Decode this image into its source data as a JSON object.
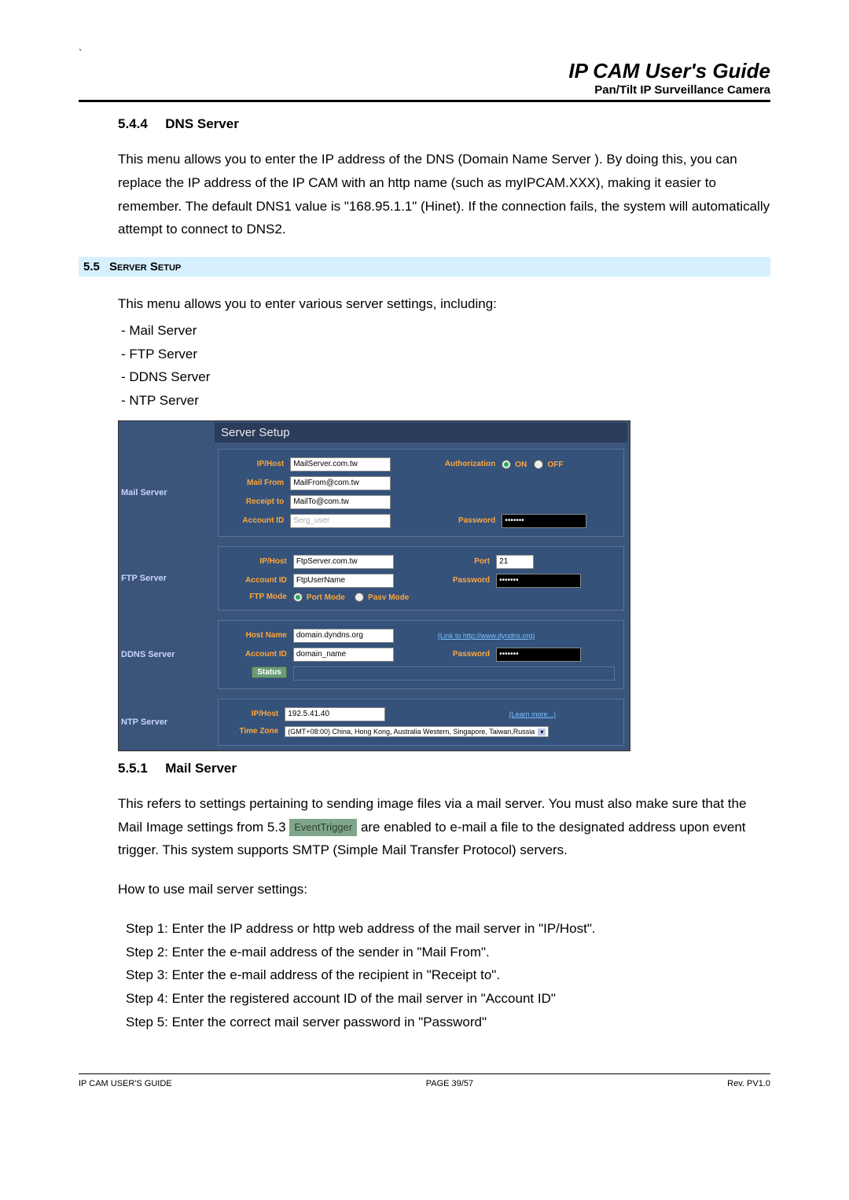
{
  "header": {
    "title": "IP CAM User's Guide",
    "subtitle": "Pan/Tilt IP Surveillance Camera"
  },
  "h544": {
    "num": "5.4.4",
    "title": "DNS Server"
  },
  "p544": "This menu allows you to enter the IP address of the DNS (Domain Name Server ). By doing this, you can replace the IP address of the IP CAM with an http name (such as myIPCAM.XXX), making it easier to remember. The default DNS1 value is \"168.95.1.1\" (Hinet). If the connection fails, the system will automatically attempt to connect to DNS2.",
  "h55": {
    "num": "5.5",
    "title": "Server Setup"
  },
  "p55_intro": "This menu allows you to enter various server settings, including:",
  "list55": [
    "Mail Server",
    "FTP Server",
    "DDNS Server",
    "NTP Server"
  ],
  "panel": {
    "title": "Server Setup",
    "mail": {
      "section": "Mail Server",
      "iphost_l": "IP/Host",
      "iphost": "MailServer.com.tw",
      "auth_l": "Authorization",
      "on": "ON",
      "off": "OFF",
      "mailfrom_l": "Mail From",
      "mailfrom": "MailFrom@com.tw",
      "receipt_l": "Receipt to",
      "receipt": "MailTo@com.tw",
      "acct_l": "Account ID",
      "acct": "Serg_user",
      "pwd_l": "Password",
      "pwd": "•••••••"
    },
    "ftp": {
      "section": "FTP Server",
      "iphost_l": "IP/Host",
      "iphost": "FtpServer.com.tw",
      "port_l": "Port",
      "port": "21",
      "acct_l": "Account ID",
      "acct": "FtpUserName",
      "pwd_l": "Password",
      "pwd": "•••••••",
      "mode_l": "FTP Mode",
      "port_mode": "Port Mode",
      "pasv_mode": "Pasv Mode"
    },
    "ddns": {
      "section": "DDNS Server",
      "host_l": "Host Name",
      "host": "domain.dyndns.org",
      "link": "(Link to http://www.dyndns.org)",
      "acct_l": "Account ID",
      "acct": "domain_name",
      "pwd_l": "Password",
      "pwd": "•••••••",
      "status_l": "Status"
    },
    "ntp": {
      "section": "NTP Server",
      "iphost_l": "IP/Host",
      "iphost": "192.5.41.40",
      "learn": "(Learn more...)",
      "tz_l": "Time Zone",
      "tz": "(GMT+08:00) China, Hong Kong, Australia Western, Singapore, Taiwan,Russia"
    }
  },
  "h551": {
    "num": "5.5.1",
    "title": "Mail Server"
  },
  "p551a": "This refers to settings pertaining to sending image files via a mail server. You must also make sure that the Mail Image settings from 5.3 ",
  "event_trigger": "EventTrigger",
  "p551b": " are enabled to e-mail a file to the designated address upon event trigger. This system supports SMTP (Simple Mail Transfer Protocol) servers.",
  "p551_howto": "How to use mail server settings:",
  "steps": [
    "Step 1: Enter the IP address or http web address of the mail server in \"IP/Host\".",
    "Step 2: Enter the e-mail address of the sender in \"Mail From\".",
    "Step 3: Enter the e-mail address of the recipient in \"Receipt to\".",
    "Step 4: Enter the registered account ID of the mail server in \"Account ID\"",
    "Step 5: Enter the correct mail server password in \"Password\""
  ],
  "footer": {
    "left": "IP CAM USER'S GUIDE",
    "center": "PAGE 39/57",
    "right": "Rev. PV1.0"
  }
}
